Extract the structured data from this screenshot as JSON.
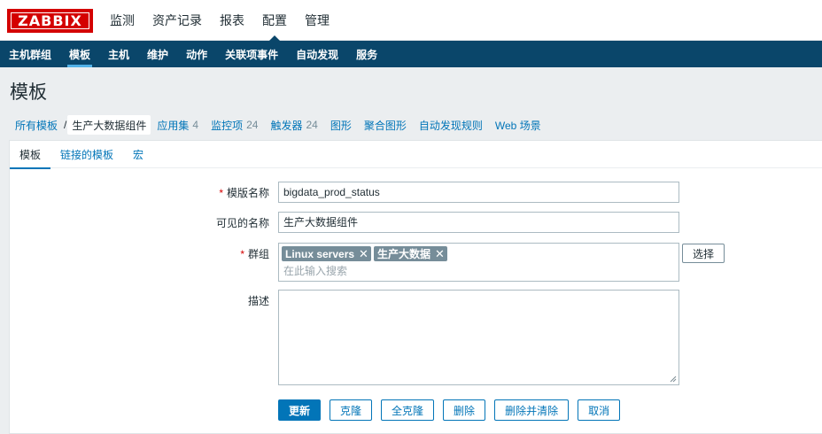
{
  "logo": "ZABBIX",
  "main_nav": [
    "监测",
    "资产记录",
    "报表",
    "配置",
    "管理"
  ],
  "sub_nav": [
    "主机群组",
    "模板",
    "主机",
    "维护",
    "动作",
    "关联项事件",
    "自动发现",
    "服务"
  ],
  "page_title": "模板",
  "breadcrumb": {
    "all_templates": "所有模板",
    "separator": "/",
    "current": "生产大数据组件",
    "items": [
      {
        "label": "应用集",
        "count": "4"
      },
      {
        "label": "监控项",
        "count": "24"
      },
      {
        "label": "触发器",
        "count": "24"
      },
      {
        "label": "图形",
        "count": ""
      },
      {
        "label": "聚合图形",
        "count": ""
      },
      {
        "label": "自动发现规则",
        "count": ""
      },
      {
        "label": "Web 场景",
        "count": ""
      }
    ]
  },
  "tabs": [
    "模板",
    "链接的模板",
    "宏"
  ],
  "form": {
    "template_name_label": "模版名称",
    "template_name_value": "bigdata_prod_status",
    "visible_name_label": "可见的名称",
    "visible_name_value": "生产大数据组件",
    "groups_label": "群组",
    "groups": [
      "Linux servers",
      "生产大数据"
    ],
    "groups_placeholder": "在此输入搜索",
    "select_button": "选择",
    "description_label": "描述",
    "description_value": "",
    "required_marker": "*"
  },
  "buttons": {
    "update": "更新",
    "clone": "克隆",
    "full_clone": "全克隆",
    "delete": "删除",
    "delete_clear": "删除并清除",
    "cancel": "取消"
  },
  "colors": {
    "logo_red": "#d40000",
    "nav_blue": "#0a466a",
    "link_blue": "#0275b8",
    "active_underline": "#52b1e7"
  }
}
